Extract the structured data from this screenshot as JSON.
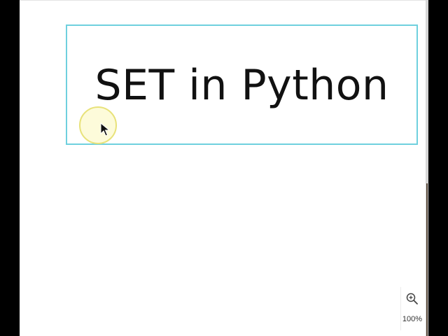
{
  "slide": {
    "title": "SET in Python"
  },
  "zoom": {
    "level_label": "100%",
    "icon": "zoom-in-icon"
  },
  "colors": {
    "frame_border": "#6fd0de",
    "cursor_halo": "#e8e27a",
    "background": "#ffffff",
    "letterbox": "#000000"
  }
}
